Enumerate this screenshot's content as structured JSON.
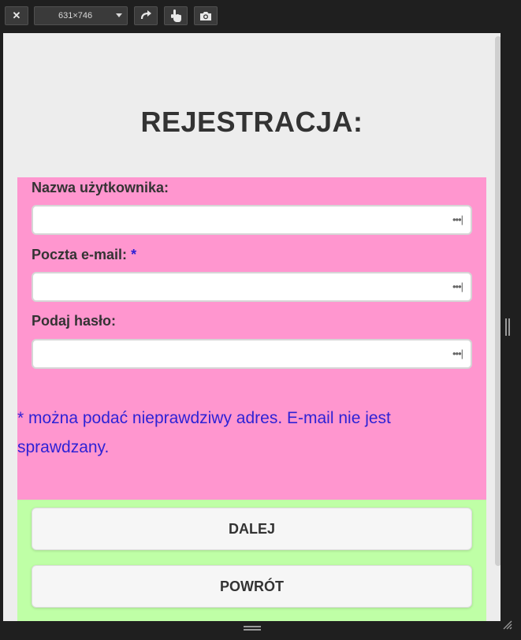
{
  "toolbar": {
    "close_icon": "close-icon",
    "device_size": "631×746",
    "rotate_icon": "rotate-icon",
    "touch_icon": "touch-icon",
    "screenshot_icon": "camera-icon"
  },
  "page": {
    "title": "REJESTRACJA:",
    "fields": [
      {
        "label": "Nazwa użytkownika:",
        "value": "",
        "suffix_icon": "password-manager-icon"
      },
      {
        "label": "Poczta e-mail:",
        "required_mark": "*",
        "value": "",
        "suffix_icon": "password-manager-icon"
      },
      {
        "label": "Podaj hasło:",
        "value": "",
        "suffix_icon": "password-manager-icon"
      }
    ],
    "note": "* można podać nieprawdziwy adres. E-mail nie jest sprawdzany.",
    "buttons": {
      "next": "DALEJ",
      "back": "POWRÓT"
    }
  },
  "colors": {
    "form_background": "#ff96cf",
    "button_area_background": "#bfffa6",
    "note_text": "#2e22d6",
    "page_background": "#ededed"
  }
}
